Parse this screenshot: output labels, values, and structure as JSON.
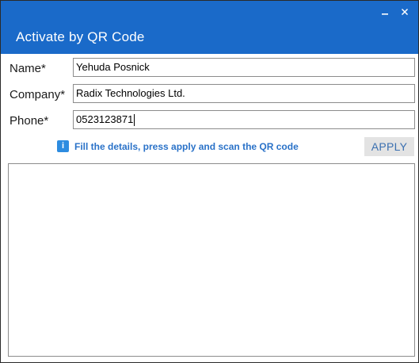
{
  "window": {
    "title": "Activate by QR Code",
    "minimize_glyph": "_",
    "close_glyph": "✕"
  },
  "form": {
    "name": {
      "label": "Name*",
      "value": "Yehuda Posnick"
    },
    "company": {
      "label": "Company*",
      "value": "Radix Technologies Ltd."
    },
    "phone": {
      "label": "Phone*",
      "value": "0523123871"
    }
  },
  "hint": {
    "icon": "info-icon",
    "text": "Fill the details, press apply and scan the QR code"
  },
  "actions": {
    "apply_label": "APPLY"
  },
  "colors": {
    "titlebar": "#1a6ac9",
    "hint_text": "#2a72c8",
    "info_icon": "#2d8ce0",
    "apply_bg": "#e3e3e3",
    "apply_text": "#3a6fb0"
  }
}
